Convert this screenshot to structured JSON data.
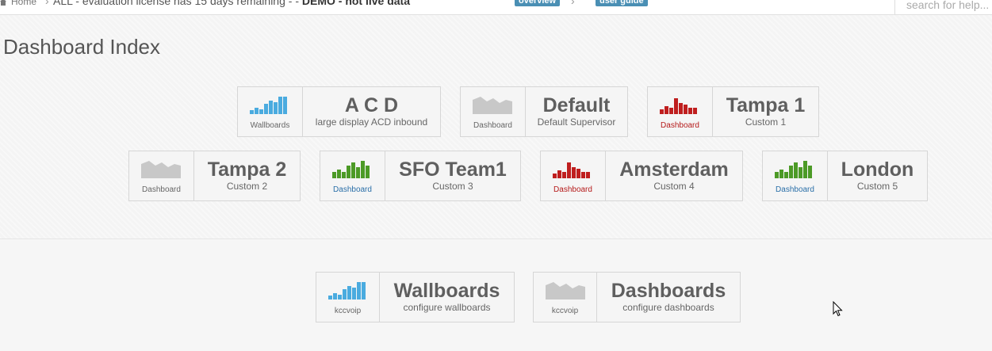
{
  "topbar": {
    "home_label": "Home",
    "notice_text": "ALL - evaluation license has 15 days remaining - - ",
    "notice_bold": "DEMO - not live data",
    "overview_label": "overview",
    "user_guide_label": "user guide",
    "search_placeholder": "search for help..."
  },
  "page": {
    "title": "Dashboard Index"
  },
  "colors": {
    "blue": "#4aabdf",
    "gray": "#c8c8c8",
    "red": "#bf1e1e",
    "green": "#4c9a26"
  },
  "dashboards": [
    {
      "icon": "blue-bar-chart-icon",
      "caption": "Wallboards",
      "name": "A C D",
      "sub": "large display ACD inbound"
    },
    {
      "icon": "gray-area-chart-icon",
      "caption": "Dashboard",
      "name": "Default",
      "sub": "Default Supervisor"
    },
    {
      "icon": "red-bar-chart-icon",
      "caption": "Dashboard",
      "name": "Tampa 1",
      "sub": "Custom 1"
    },
    {
      "icon": "gray-area-chart-icon",
      "caption": "Dashboard",
      "name": "Tampa 2",
      "sub": "Custom 2"
    },
    {
      "icon": "green-bar-chart-icon",
      "caption": "Dashboard",
      "name": "SFO Team1",
      "sub": "Custom 3"
    },
    {
      "icon": "red-bar-chart-icon",
      "caption": "Dashboard",
      "name": "Amsterdam",
      "sub": "Custom 4"
    },
    {
      "icon": "green-bar-chart-icon",
      "caption": "Dashboard",
      "name": "London",
      "sub": "Custom 5"
    }
  ],
  "config": [
    {
      "icon": "blue-bar-chart-icon",
      "caption": "kccvoip",
      "name": "Wallboards",
      "sub": "configure wallboards"
    },
    {
      "icon": "gray-area-chart-icon",
      "caption": "kccvoip",
      "name": "Dashboards",
      "sub": "configure dashboards"
    }
  ]
}
